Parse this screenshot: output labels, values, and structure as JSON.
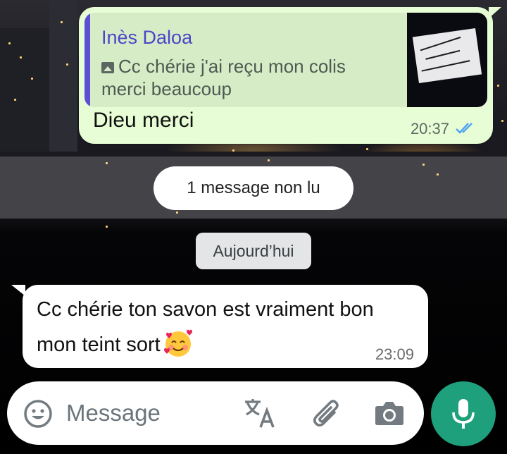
{
  "quoted_message": {
    "sender": "Inès Daloa",
    "text": "Cc chérie j'ai reçu mon colis merci beaucoup",
    "thumbnail_icon": "photo-icon"
  },
  "outgoing_message": {
    "text": "Dieu merci",
    "time": "20:37",
    "status_icon": "double-check-icon",
    "status_color": "#4fa3f0"
  },
  "unread_banner": "1 message non lu",
  "date_divider": "Aujourd’hui",
  "incoming_message": {
    "text": "Cc chérie ton savon est vraiment bon mon teint sort",
    "emoji": "smiling-face-with-hearts",
    "time": "23:09"
  },
  "composer": {
    "placeholder": "Message",
    "value": "",
    "icons": [
      "emoji-icon",
      "translate-icon",
      "paperclip-icon",
      "camera-icon",
      "mic-icon"
    ],
    "send_button_color": "#1fa07d"
  },
  "colors": {
    "outgoing_bubble": "#e7fdd5",
    "quote_bar": "#5b4fd6",
    "quote_name": "#4d45c9",
    "incoming_bubble": "#ffffff"
  }
}
